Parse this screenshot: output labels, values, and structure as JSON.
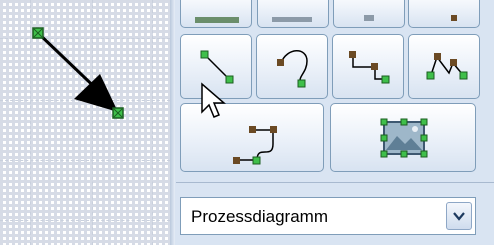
{
  "diagram_type_select": {
    "value": "Prozessdiagramm"
  },
  "icons": {
    "straight_connector": "straight-connector-icon",
    "curved_connector": "curved-connector-icon",
    "elbow_connector": "elbow-connector-icon",
    "multi_segment_connector": "multi-segment-connector-icon",
    "curved_elbow_connector": "curved-elbow-connector-icon",
    "image_shape": "image-shape-icon",
    "dropdown_arrow": "chevron-down-icon"
  },
  "colors": {
    "panel_bg": "#d9e4f2",
    "button_border": "#7f9db9",
    "handle_green": "#2e8b3a",
    "point_brown": "#6b4a24"
  }
}
